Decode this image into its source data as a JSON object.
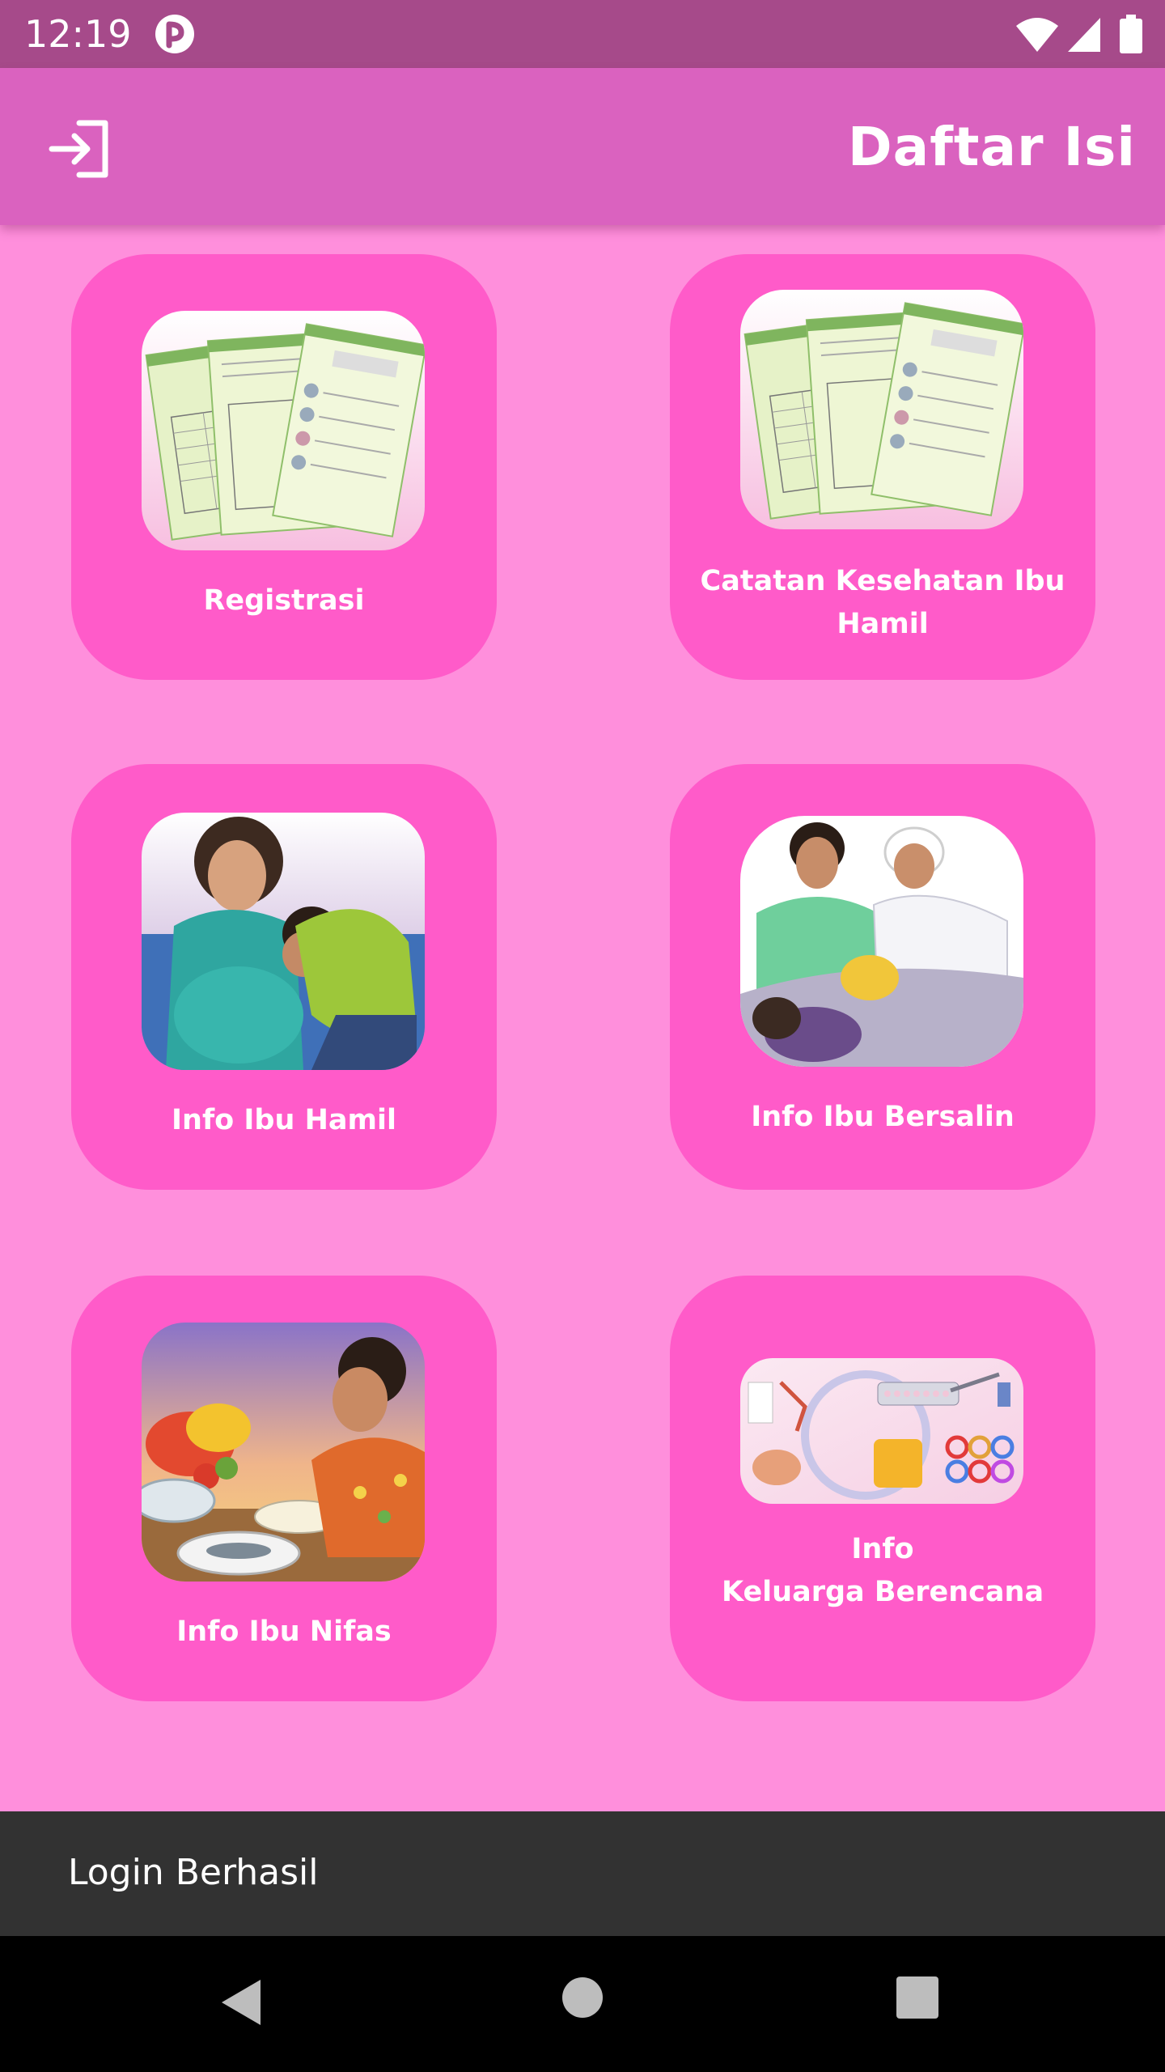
{
  "status_bar": {
    "time": "12:19"
  },
  "app_bar": {
    "title": "Daftar Isi",
    "login_icon": "login-arrow-icon"
  },
  "menu": {
    "items": [
      {
        "label": "Registrasi",
        "image": "document-forms-image"
      },
      {
        "label_lines": [
          "Catatan Kesehatan Ibu",
          "Hamil"
        ],
        "image": "document-forms-image"
      },
      {
        "label": "Info Ibu Hamil",
        "image": "pregnant-couple-illustration"
      },
      {
        "label": "Info Ibu Bersalin",
        "image": "childbirth-illustration"
      },
      {
        "label": "Info Ibu Nifas",
        "image": "mother-eating-illustration"
      },
      {
        "label_lines": [
          "Info",
          "Keluarga Berencana"
        ],
        "image": "contraception-illustration"
      }
    ]
  },
  "snackbar": {
    "message": "Login Berhasil"
  },
  "colors": {
    "status_bar": "#a64a8a",
    "app_bar": "#da62bf",
    "background": "#ff8fdc",
    "card": "#ff5bc9",
    "snackbar": "#323232"
  }
}
